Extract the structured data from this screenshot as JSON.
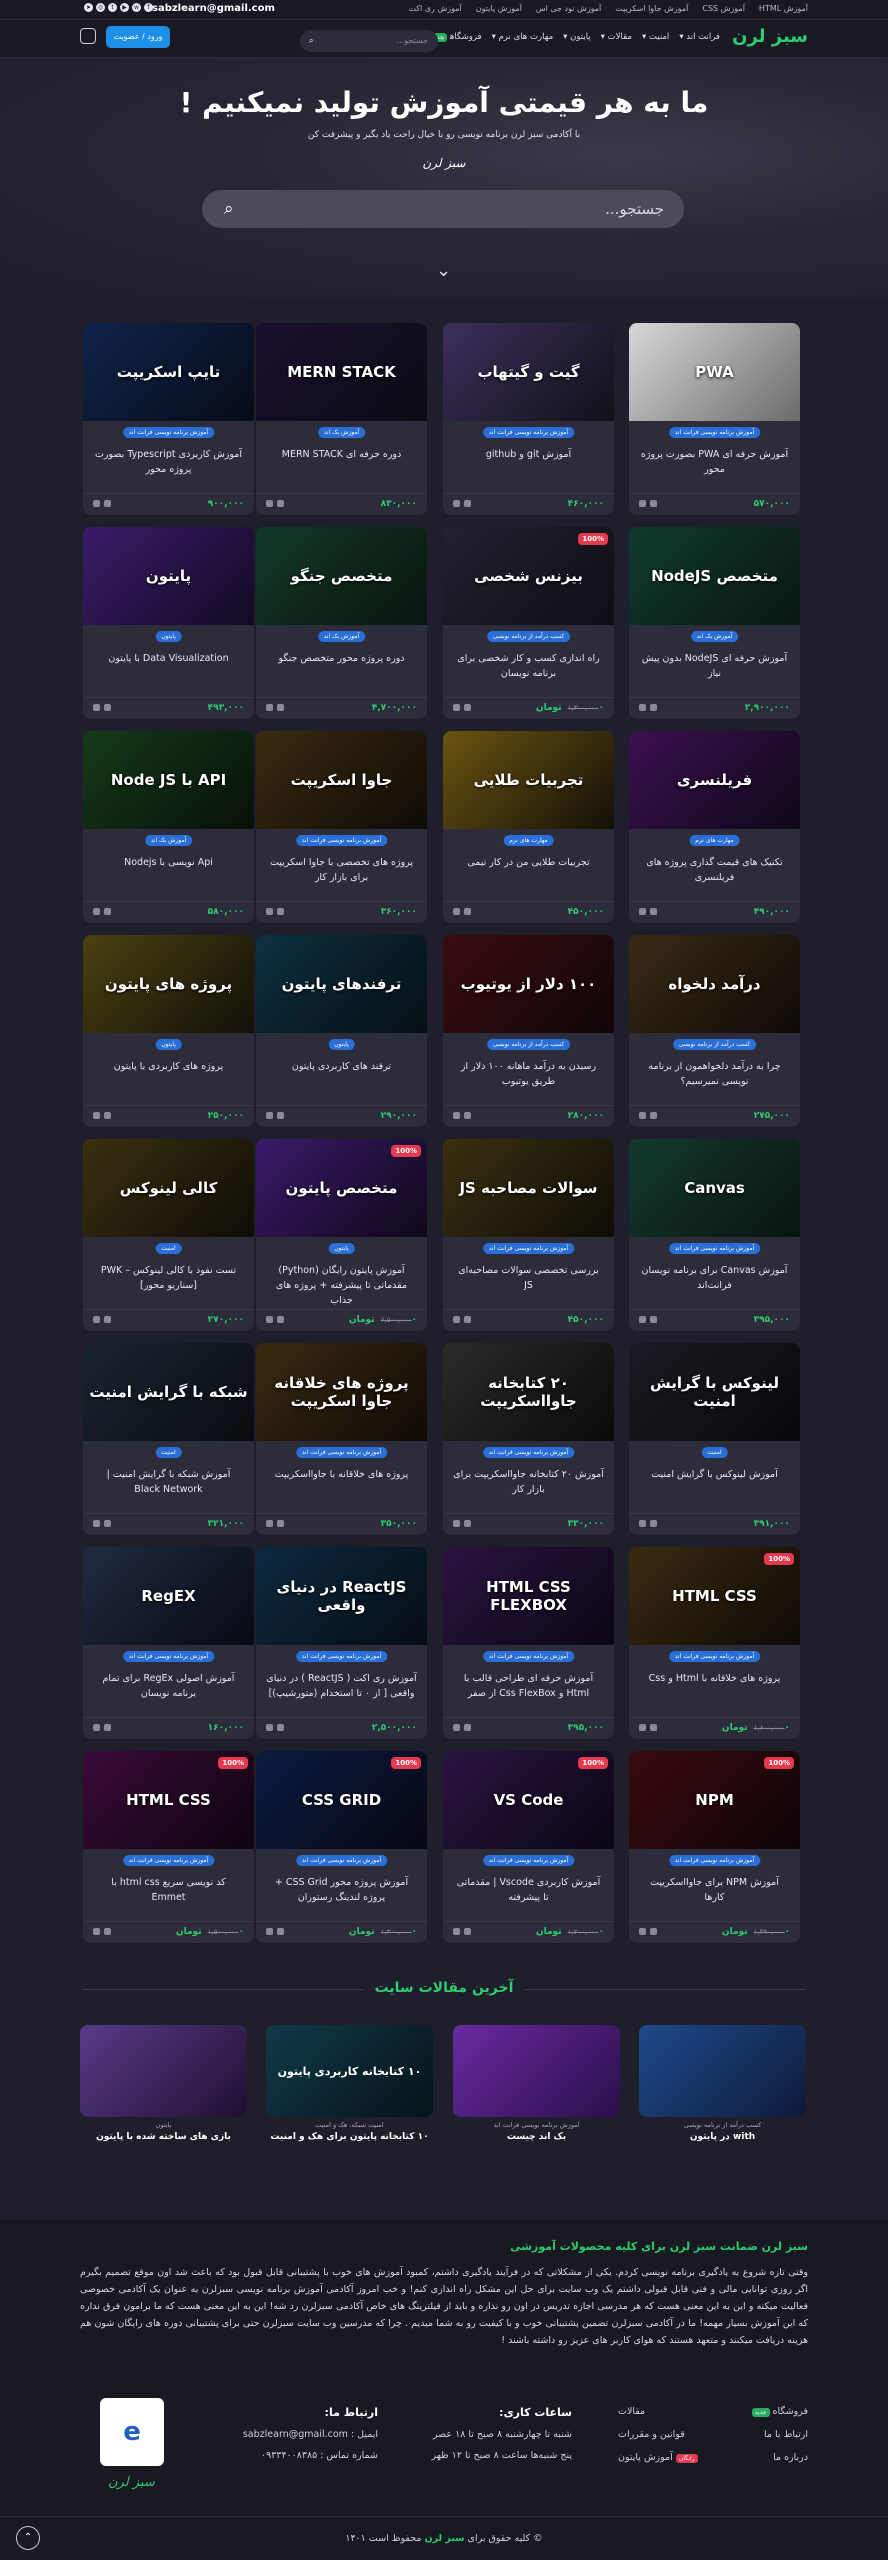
{
  "topbar": {
    "email": "sabzlearn@gmail.com",
    "links": [
      "آموزش HTML",
      "آموزش CSS",
      "آموزش جاوا اسکریپت",
      "آموزش نود جی اس",
      "آموزش پایتون",
      "آموزش ری اکت"
    ]
  },
  "header": {
    "logo": "سبز لرن",
    "menu": [
      "فرانت اند",
      "امنیت",
      "مقالات",
      "پایتون",
      "مهارت های نرم",
      "فروشگاه"
    ],
    "shop_badge": "جدید",
    "search_placeholder": "جستجو...",
    "login": "ورود / عضویت"
  },
  "hero": {
    "title": "ما به هر قیمتی آموزش تولید نمیکنیم !",
    "subtitle": "با آکادمی سبز لرن برنامه نویسی رو با خیال راحت یاد بگیر و پیشرفت کن",
    "signature": "سبز لرن",
    "search_placeholder": "جستجو..."
  },
  "courses": [
    {
      "thumb": "PWA",
      "tag": "آموزش برنامه نویسی فرانت اند",
      "title": "آموزش حرفه ای PWA بصورت پروژه محور",
      "price": "۵۷۰,۰۰۰",
      "old": "",
      "discount": "",
      "c1": "#d8d8d8",
      "c2": "#6b6b6b"
    },
    {
      "thumb": "گیت و گیتهاب",
      "tag": "آموزش برنامه نویسی فرانت اند",
      "title": "آموزش git و github",
      "price": "۴۶۰,۰۰۰",
      "old": "",
      "discount": "",
      "c1": "#3d2f5c",
      "c2": "#111118"
    },
    {
      "thumb": "MERN STACK",
      "tag": "آموزش بک اند",
      "title": "دوره حرفه ای MERN STACK",
      "price": "۸۳۰,۰۰۰",
      "old": "",
      "discount": "",
      "c1": "#1b1030",
      "c2": "#0b0b12"
    },
    {
      "thumb": "تایپ اسکریپت",
      "tag": "آموزش برنامه نویسی فرانت اند",
      "title": "آموزش کاربردی Typescript بصورت پروژه محور",
      "price": "۹۰۰,۰۰۰",
      "old": "",
      "discount": "",
      "c1": "#10244a",
      "c2": "#070b18"
    },
    {
      "thumb": "متخصص NodeJS",
      "tag": "آموزش بک اند",
      "title": "آموزش حرفه ای NodeJS بدون پیش نیاز",
      "price": "۲,۹۰۰,۰۰۰",
      "old": "",
      "discount": "",
      "c1": "#0f3b2a",
      "c2": "#0a1712"
    },
    {
      "thumb": "بیزنس شخصی",
      "tag": "کسب درآمد از برنامه نویسی",
      "title": "راه اندازی کسب و کار شخصی برای برنامه نویسان",
      "price": "۰ تومان",
      "old": "۱,۳۰۰,۰۰۰",
      "discount": "100%",
      "c1": "#222230",
      "c2": "#0d0d14"
    },
    {
      "thumb": "متخصص جنگو",
      "tag": "آموزش بک اند",
      "title": "دوره پروژه محور متخصص جنگو",
      "price": "۴,۷۰۰,۰۰۰",
      "old": "",
      "discount": "",
      "c1": "#123a26",
      "c2": "#0a140f"
    },
    {
      "thumb": "پایتون",
      "tag": "پایتون",
      "title": "Data Visualization با پایتون",
      "price": "۴۹۳,۰۰۰",
      "old": "",
      "discount": "",
      "c1": "#3a1c6a",
      "c2": "#120a22"
    },
    {
      "thumb": "فریلنسری",
      "tag": "مهارت های نرم",
      "title": "تکنیک های قیمت گذاری پروژه های فریلنسری",
      "price": "۴۹۰,۰۰۰",
      "old": "",
      "discount": "",
      "c1": "#3d1050",
      "c2": "#0d0818"
    },
    {
      "thumb": "تجربیات طلایی",
      "tag": "مهارت های نرم",
      "title": "تجربیات طلایی من در کار تیمی",
      "price": "۴۵۰,۰۰۰",
      "old": "",
      "discount": "",
      "c1": "#6a5410",
      "c2": "#141008"
    },
    {
      "thumb": "جاوا اسکریپت",
      "tag": "آموزش برنامه نویسی فرانت اند",
      "title": "پروژه های تخصصی با جاوا اسکریپت برای بازار کار",
      "price": "۳۶۰,۰۰۰",
      "old": "",
      "discount": "",
      "c1": "#3a2a10",
      "c2": "#0e0b06"
    },
    {
      "thumb": "API با Node JS",
      "tag": "آموزش بک اند",
      "title": "Api نویسی با Nodejs",
      "price": "۵۸۰,۰۰۰",
      "old": "",
      "discount": "",
      "c1": "#143a1a",
      "c2": "#081008"
    },
    {
      "thumb": "درآمد دلخواه",
      "tag": "کسب درآمد از برنامه نویسی",
      "title": "چرا به درآمد دلخواهمون از برنامه نویسی نمیرسیم؟",
      "price": "۲۷۵,۰۰۰",
      "old": "",
      "discount": "",
      "c1": "#3a2a14",
      "c2": "#0e0a06"
    },
    {
      "thumb": "۱۰۰ دلار از یوتیوب",
      "tag": "کسب درآمد از برنامه نویسی",
      "title": "رسیدن به درآمد ماهانه ۱۰۰ دلار از طریق یوتیوب",
      "price": "۲۸۰,۰۰۰",
      "old": "",
      "discount": "",
      "c1": "#3a0c10",
      "c2": "#100608"
    },
    {
      "thumb": "ترفندهای پایتون",
      "tag": "پایتون",
      "title": "ترفند های کاربردی پایتون",
      "price": "۲۹۰,۰۰۰",
      "old": "",
      "discount": "",
      "c1": "#0c3040",
      "c2": "#060e14"
    },
    {
      "thumb": "پروژه های پایتون",
      "tag": "پایتون",
      "title": "پروژه های کاربردی با پایتون",
      "price": "۲۵۰,۰۰۰",
      "old": "",
      "discount": "",
      "c1": "#4a4010",
      "c2": "#12100a"
    },
    {
      "thumb": "Canvas",
      "tag": "آموزش برنامه نویسی فرانت اند",
      "title": "آموزش Canvas برای برنامه نویسان فرانت‌اند",
      "price": "۳۹۵,۰۰۰",
      "old": "",
      "discount": "",
      "c1": "#123a2c",
      "c2": "#0a1410"
    },
    {
      "thumb": "سوالات مصاحبه JS",
      "tag": "آموزش برنامه نویسی فرانت اند",
      "title": "بررسی تخصصی سوالات مصاحبه‌ای JS",
      "price": "۴۵۰,۰۰۰",
      "old": "",
      "discount": "",
      "c1": "#3a3010",
      "c2": "#0e0c06"
    },
    {
      "thumb": "متخصص پایتون",
      "tag": "پایتون",
      "title": "آموزش پایتون رایگان (Python) مقدماتی تا پیشرفته + پروژه های جذاب",
      "price": "۰ تومان",
      "old": "۶,۵۰۰,۰۰۰",
      "discount": "100%",
      "c1": "#3a1a6a",
      "c2": "#0e0818"
    },
    {
      "thumb": "کالی لینوکس",
      "tag": "امنیت",
      "title": "تست نفوذ با کالی لینوکس – PWK [سناریو محور]",
      "price": "۲۷۰,۰۰۰",
      "old": "",
      "discount": "",
      "c1": "#3a3010",
      "c2": "#0e0c06"
    },
    {
      "thumb": "لینوکس با گرایش امنیت",
      "tag": "امنیت",
      "title": "آموزش لینوکس با گرایش امنیت",
      "price": "۳۹۱,۰۰۰",
      "old": "",
      "discount": "",
      "c1": "#1a1a22",
      "c2": "#08080c"
    },
    {
      "thumb": "۲۰ کتابخانه جاوااسکریپت",
      "tag": "آموزش برنامه نویسی فرانت اند",
      "title": "آموزش ۲۰ کتابخانه جاوااسکریپت برای بازار کار",
      "price": "۳۳۰,۰۰۰",
      "old": "",
      "discount": "",
      "c1": "#2a2a2a",
      "c2": "#0a0a0a"
    },
    {
      "thumb": "پروژه های خلاقانه جاوا اسکریپت",
      "tag": "آموزش برنامه نویسی فرانت اند",
      "title": "پروژه های خلاقانه با جاوااسکریپت",
      "price": "۳۵۰,۰۰۰",
      "old": "",
      "discount": "",
      "c1": "#3a2a10",
      "c2": "#0e0a06"
    },
    {
      "thumb": "شبکه با گرایش امنیت",
      "tag": "امنیت",
      "title": "آموزش شبکه با گرایش امنیت | Black Network",
      "price": "۳۲۱,۰۰۰",
      "old": "",
      "discount": "",
      "c1": "#1a2430",
      "c2": "#080c10"
    },
    {
      "thumb": "HTML CSS",
      "tag": "آموزش برنامه نویسی فرانت اند",
      "title": "پروژه های خلاقانه با Html و Css",
      "price": "۰ تومان",
      "old": "۱,۶۰۰,۰۰۰",
      "discount": "100%",
      "c1": "#3a2a10",
      "c2": "#0e0a06"
    },
    {
      "thumb": "HTML CSS FLEXBOX",
      "tag": "آموزش برنامه نویسی فرانت اند",
      "title": "آموزش حرفه ای طراحی قالب با Html و Css FlexBox از صفر",
      "price": "۳۹۵,۰۰۰",
      "old": "",
      "discount": "",
      "c1": "#2a1440",
      "c2": "#0a0614"
    },
    {
      "thumb": "ReactJS در دنیای واقعی",
      "tag": "آموزش برنامه نویسی فرانت اند",
      "title": "آموزش ری اکت ( ReactJS ) در دنیای واقعی [ از ۰ تا استخدام (متورشیپ)]",
      "price": "۲,۵۰۰,۰۰۰",
      "old": "",
      "discount": "",
      "c1": "#0c2a40",
      "c2": "#060c14"
    },
    {
      "thumb": "RegEX",
      "tag": "آموزش برنامه نویسی فرانت اند",
      "title": "آموزش اصولی RegEx برای تمام برنامه نویسان",
      "price": "۱۶۰,۰۰۰",
      "old": "",
      "discount": "",
      "c1": "#202a40",
      "c2": "#080a12"
    },
    {
      "thumb": "NPM",
      "tag": "آموزش برنامه نویسی فرانت اند",
      "title": "آموزش NPM برای جاوااسکریپت کارها",
      "price": "۰ تومان",
      "old": "۱,۴۹۰,۰۰۰",
      "discount": "100%",
      "c1": "#3a0a10",
      "c2": "#0e0406"
    },
    {
      "thumb": "VS Code",
      "tag": "آموزش برنامه نویسی فرانت اند",
      "title": "آموزش کاربردی Vscode | مقدماتی تا پیشرفته",
      "price": "۰ تومان",
      "old": "۱,۲۰۰,۰۰۰",
      "discount": "100%",
      "c1": "#2a1440",
      "c2": "#0a0614"
    },
    {
      "thumb": "CSS GRID",
      "tag": "آموزش برنامه نویسی فرانت اند",
      "title": "آموزش پروژه محور CSS Grid + پروژه لندینگ رستوران",
      "price": "۰ تومان",
      "old": "۱,۳۰۰,۰۰۰",
      "discount": "100%",
      "c1": "#0c1a40",
      "c2": "#060814"
    },
    {
      "thumb": "HTML CSS",
      "tag": "آموزش برنامه نویسی فرانت اند",
      "title": "کد نویسی سریع html css با Emmet",
      "price": "۰ تومان",
      "old": "۱,۵۰۰,۰۰۰",
      "discount": "100%",
      "c1": "#3a0a3a",
      "c2": "#0e040e"
    }
  ],
  "articles_title": "آخرین مقالات سایت",
  "articles": [
    {
      "thumb": "",
      "cat": "کسب درآمد از برنامه نویسی",
      "title": "with در پایتون",
      "c1": "#1e4a8a",
      "c2": "#0e1a3a"
    },
    {
      "thumb": "",
      "cat": "آموزش برنامه نویسی فرانت اند",
      "title": "بک اند چیست",
      "c1": "#6a2aa0",
      "c2": "#2a0e4a"
    },
    {
      "thumb": "۱۰ کتابخانه کاربردی پایتون",
      "cat": "امنیت شبکه، هک و امنیت",
      "title": "۱۰ کتابخانه پایتون برای هک و امنیت",
      "c1": "#103a4a",
      "c2": "#061218"
    },
    {
      "thumb": "",
      "cat": "پایتون",
      "title": "بازی های ساخته شده با پایتون",
      "c1": "#5a3a8a",
      "c2": "#1e1030"
    }
  ],
  "footer": {
    "guarantee": "سبز لرن ضمانت سبز لرن برای کلیه محصولات آموزشی",
    "about": "وقتی تازه شروع به یادگیری برنامه نویسی کردم. یکی از مشکلاتی که در فرآیند یادگیری داشتم، کمبود آموزش های خوب با پشتیبانی قابل قبول بود که باعث شد اون موقع تصمیم بگیرم اگر روزی توانایی مالی و فنی قابل قبولی داشتم یک وب سایت برای حل این مشکل راه اندازی کنم! و خب امروز آکادمی آموزش برنامه نویسی سبزلرن به عنوان یک آکادمی خصوصی فعالیت میکنه و این به این معنی هست که هر مدرسی اجازه تدریس در اون رو نداره و باید از فیلترینگ های خاص آکادمی سبزلرن رد شه! این به این معنی هست که ما برامون فرق نداره که این آموزش بسیار مهمه! ما در آکادمی سبزلرن تضمین پشتیبانی خوب و با کیفیت رو به شما میدیم . چرا که مدرسین وب سایت سبزلرن حتی برای پشتیبانی دوره های رایگان شون هم هزینه دریافت میکنند و متعهد هستند که هوای کاربر های عزیز رو داشته باشند !",
    "links": [
      {
        "a": "فروشگاه",
        "b": "مقالات",
        "badge": "جدید",
        "red": false
      },
      {
        "a": "ارتباط با ما",
        "b": "قوانین و مقررات",
        "badge": "",
        "red": false
      },
      {
        "a": "درباره ما",
        "b": "آموزش پایتون",
        "badge": "رایگان",
        "red": true
      }
    ],
    "sched_title": "ساعات کاری:",
    "sched": [
      "شنبه تا چهارشنبه ۸ صبح تا ۱۸ عصر",
      "پنج شنبه‌ها ساعت ۸ صبح تا ۱۲ ظهر"
    ],
    "contact_title": "ارتباط ما:",
    "contact": [
      "ایمیل : sabzlearn@gmail.com",
      "شماره تماس : ۰۹۳۳۴۰۰۸۳۸۵"
    ],
    "enamad": "e",
    "footer_logo": "سبز لرن",
    "copyright_pre": "© کلیه حقوق برای",
    "copyright_brand": "سبز لرن",
    "copyright_post": "محفوظ است ۱۴۰۱"
  },
  "colors": {
    "accent": "#2ecc71",
    "blue": "#1e8fe6",
    "red": "#e53950"
  }
}
